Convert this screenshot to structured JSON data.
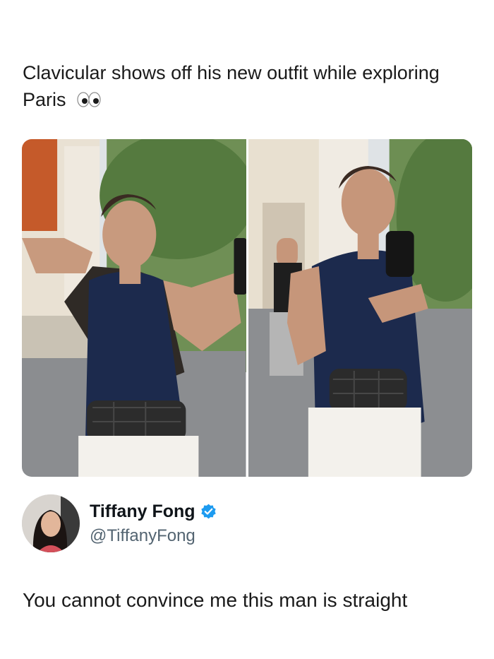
{
  "post": {
    "caption": "Clavicular shows off his new outfit while exploring Paris",
    "caption_emoji_icon": "eyes-icon",
    "media": [
      {
        "alt_icon": "photo-left-icon"
      },
      {
        "alt_icon": "photo-right-icon"
      }
    ]
  },
  "author": {
    "display_name": "Tiffany Fong",
    "handle": "@TiffanyFong",
    "verified_icon": "verified-badge-icon",
    "verified_color": "#1d9bf0"
  },
  "tweet": {
    "text": "You cannot convince me this man is straight"
  }
}
